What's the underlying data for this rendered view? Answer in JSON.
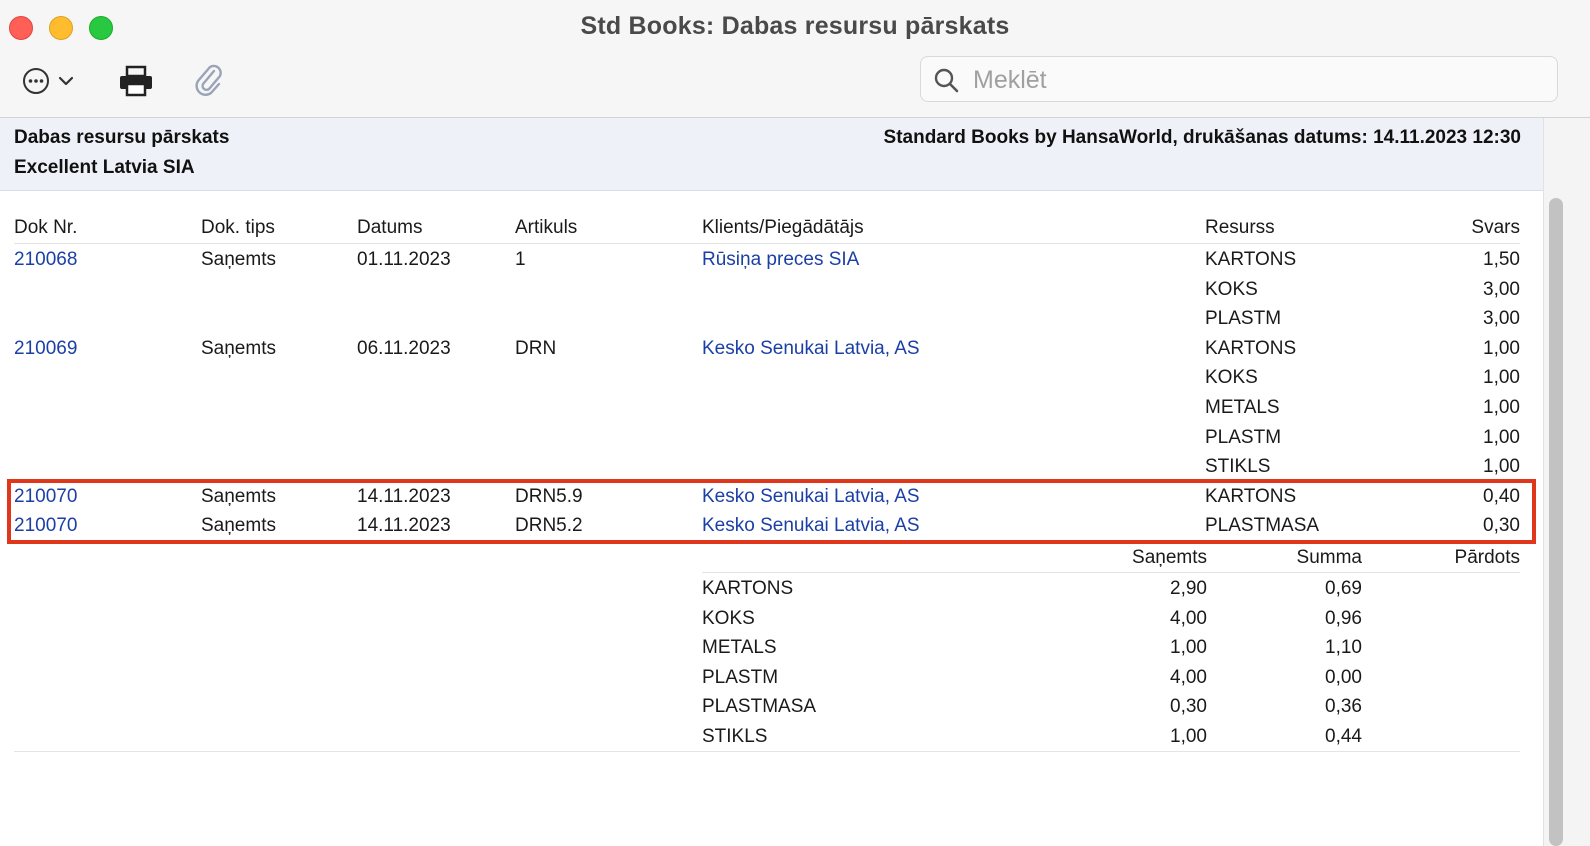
{
  "window": {
    "title": "Std Books: Dabas resursu pārskats"
  },
  "toolbar": {
    "search_placeholder": "Meklēt"
  },
  "report_header": {
    "report_name": "Dabas resursu pārskats",
    "company": "Excellent Latvia SIA",
    "printed_by": "Standard Books by HansaWorld, drukāšanas datums: 14.11.2023 12:30"
  },
  "columns": {
    "doc_nr": "Dok Nr.",
    "doc_type": "Dok. tips",
    "date": "Datums",
    "item": "Artikuls",
    "client": "Klients/Piegādātājs",
    "resource": "Resurss",
    "weight": "Svars"
  },
  "rows": [
    {
      "doc_nr": "210068",
      "doc_type": "Saņemts",
      "date": "01.11.2023",
      "item": "1",
      "client": "Rūsiņa preces SIA",
      "resource": "KARTONS",
      "weight": "1,50"
    },
    {
      "doc_nr": "",
      "doc_type": "",
      "date": "",
      "item": "",
      "client": "",
      "resource": "KOKS",
      "weight": "3,00"
    },
    {
      "doc_nr": "",
      "doc_type": "",
      "date": "",
      "item": "",
      "client": "",
      "resource": "PLASTM",
      "weight": "3,00"
    },
    {
      "doc_nr": "210069",
      "doc_type": "Saņemts",
      "date": "06.11.2023",
      "item": "DRN",
      "client": "Kesko Senukai Latvia, AS",
      "resource": "KARTONS",
      "weight": "1,00"
    },
    {
      "doc_nr": "",
      "doc_type": "",
      "date": "",
      "item": "",
      "client": "",
      "resource": "KOKS",
      "weight": "1,00"
    },
    {
      "doc_nr": "",
      "doc_type": "",
      "date": "",
      "item": "",
      "client": "",
      "resource": "METALS",
      "weight": "1,00"
    },
    {
      "doc_nr": "",
      "doc_type": "",
      "date": "",
      "item": "",
      "client": "",
      "resource": "PLASTM",
      "weight": "1,00"
    },
    {
      "doc_nr": "",
      "doc_type": "",
      "date": "",
      "item": "",
      "client": "",
      "resource": "STIKLS",
      "weight": "1,00"
    },
    {
      "doc_nr": "210070",
      "doc_type": "Saņemts",
      "date": "14.11.2023",
      "item": "DRN5.9",
      "client": "Kesko Senukai Latvia, AS",
      "resource": "KARTONS",
      "weight": "0,40"
    },
    {
      "doc_nr": "210070",
      "doc_type": "Saņemts",
      "date": "14.11.2023",
      "item": "DRN5.2",
      "client": "Kesko Senukai Latvia, AS",
      "resource": "PLASTMASA",
      "weight": "0,30"
    }
  ],
  "summary_columns": {
    "received": "Saņemts",
    "sum": "Summa",
    "sold": "Pārdots"
  },
  "summary": [
    {
      "resource": "KARTONS",
      "received": "2,90",
      "sum": "0,69",
      "sold": ""
    },
    {
      "resource": "KOKS",
      "received": "4,00",
      "sum": "0,96",
      "sold": ""
    },
    {
      "resource": "METALS",
      "received": "1,00",
      "sum": "1,10",
      "sold": ""
    },
    {
      "resource": "PLASTM",
      "received": "4,00",
      "sum": "0,00",
      "sold": ""
    },
    {
      "resource": "PLASTMASA",
      "received": "0,30",
      "sum": "0,36",
      "sold": ""
    },
    {
      "resource": "STIKLS",
      "received": "1,00",
      "sum": "0,44",
      "sold": ""
    }
  ],
  "colors": {
    "link": "#1b3fa6",
    "highlight_border": "#e0361b",
    "header_band": "#eef2f8"
  }
}
